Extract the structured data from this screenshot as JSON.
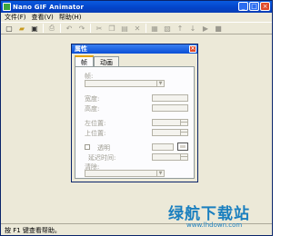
{
  "window": {
    "title": "Nano GIF Animator"
  },
  "menu": [
    "文件(F)",
    "查看(V)",
    "帮助(H)"
  ],
  "toolbar": {
    "icons": [
      {
        "name": "new-icon",
        "glyph": "▢"
      },
      {
        "name": "open-icon",
        "glyph": "▰"
      },
      {
        "name": "save-icon",
        "glyph": "▣"
      },
      {
        "name": "print-icon",
        "glyph": "⎙"
      },
      {
        "name": "undo-icon",
        "glyph": "↶"
      },
      {
        "name": "redo-icon",
        "glyph": "↷"
      },
      {
        "name": "cut-icon",
        "glyph": "✂"
      },
      {
        "name": "copy-icon",
        "glyph": "❐"
      },
      {
        "name": "paste-icon",
        "glyph": "▤"
      },
      {
        "name": "delete-icon",
        "glyph": "✕"
      },
      {
        "name": "frame-add-icon",
        "glyph": "▦"
      },
      {
        "name": "frame-import-icon",
        "glyph": "▧"
      },
      {
        "name": "move-up-icon",
        "glyph": "↑"
      },
      {
        "name": "move-down-icon",
        "glyph": "↓"
      },
      {
        "name": "play-icon",
        "glyph": "▶"
      },
      {
        "name": "stop-icon",
        "glyph": "■"
      }
    ]
  },
  "dialog": {
    "title": "属性",
    "tabs": [
      "帧",
      "动画"
    ],
    "fields": {
      "frame_label": "帧:",
      "width_label": "宽度:",
      "height_label": "高度:",
      "left_label": "左位置:",
      "top_label": "上位置:",
      "transparent_label": "透明",
      "delay_label": "延迟时间:",
      "dispose_label": "清除:"
    }
  },
  "status": {
    "text": "按 F1 键查看帮助。"
  },
  "watermark": {
    "text": "绿航下载站",
    "url": "www.lhdown.com"
  }
}
